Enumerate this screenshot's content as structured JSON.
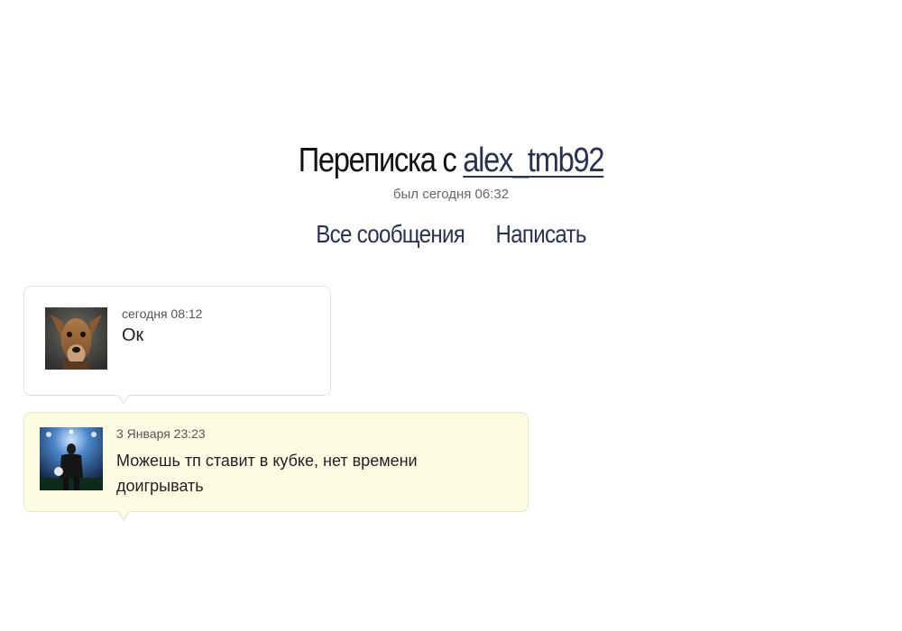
{
  "header": {
    "title_prefix": "Переписка с",
    "username": "alex_tmb92",
    "last_seen": "был сегодня 06:32"
  },
  "nav": {
    "all_messages": "Все сообщения",
    "write": "Написать"
  },
  "messages": [
    {
      "timestamp": "сегодня 08:12",
      "text": "Ок",
      "avatar": "dog-photo-avatar",
      "background": "#ffffff"
    },
    {
      "timestamp": "3 Января 23:23",
      "text": "Можешь тп ставит в кубке, нет времени доигрывать",
      "avatar": "football-player-avatar",
      "background": "#fdfde3"
    }
  ],
  "colors": {
    "link": "#2b3152",
    "title": "#111111"
  }
}
